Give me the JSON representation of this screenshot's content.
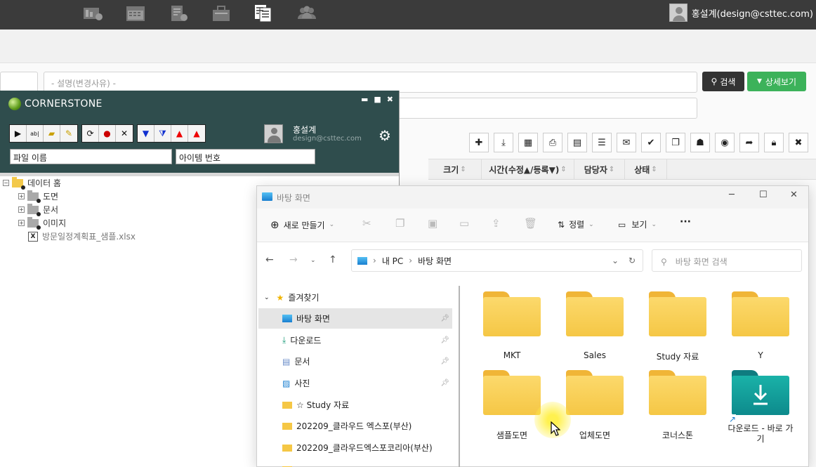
{
  "topbar": {
    "user_label": "홍설계(design@csttec.com)",
    "icons": [
      "dashboard-icon",
      "calendar-icon",
      "document-settings-icon",
      "toolbox-icon",
      "documents-icon",
      "users-icon"
    ]
  },
  "search": {
    "description_placeholder": "- 설명(변경사유) -",
    "search_button": "검색",
    "detail_button": "상세보기"
  },
  "table": {
    "columns": [
      "크기",
      "시간(수정▲/등록▼)",
      "담당자",
      "상태"
    ]
  },
  "cornerstone": {
    "title": "CORNERSTONE",
    "user_name": "홍설계",
    "user_email": "design@csttec.com",
    "filename_value": "파일 이름",
    "item_no_value": "아이템 번호",
    "tree": [
      {
        "label": "데이터 홈"
      },
      {
        "label": "도면"
      },
      {
        "label": "문서"
      },
      {
        "label": "이미지"
      },
      {
        "label": "방문일정계획표_샘플.xlsx"
      }
    ]
  },
  "explorer": {
    "title": "바탕 화면",
    "new_label": "새로 만들기",
    "sort_label": "정렬",
    "view_label": "보기",
    "more_label": "···",
    "breadcrumb": [
      "내 PC",
      "바탕 화면"
    ],
    "search_placeholder": "바탕 화면 검색",
    "sidebar": [
      {
        "label": "즐겨찾기"
      },
      {
        "label": "바탕 화면"
      },
      {
        "label": "다운로드"
      },
      {
        "label": "문서"
      },
      {
        "label": "사진"
      },
      {
        "label": "☆ Study 자료"
      },
      {
        "label": "202209_클라우드 엑스포(부산)"
      },
      {
        "label": "202209_클라우드엑스포코리아(부산)"
      }
    ],
    "items": [
      {
        "label": "MKT"
      },
      {
        "label": "Sales"
      },
      {
        "label": "Study 자료"
      },
      {
        "label": "Y"
      },
      {
        "label": "샘플도면"
      },
      {
        "label": "업체도면"
      },
      {
        "label": "코너스톤"
      },
      {
        "label": "다운로드 - 바로 가기"
      }
    ]
  }
}
